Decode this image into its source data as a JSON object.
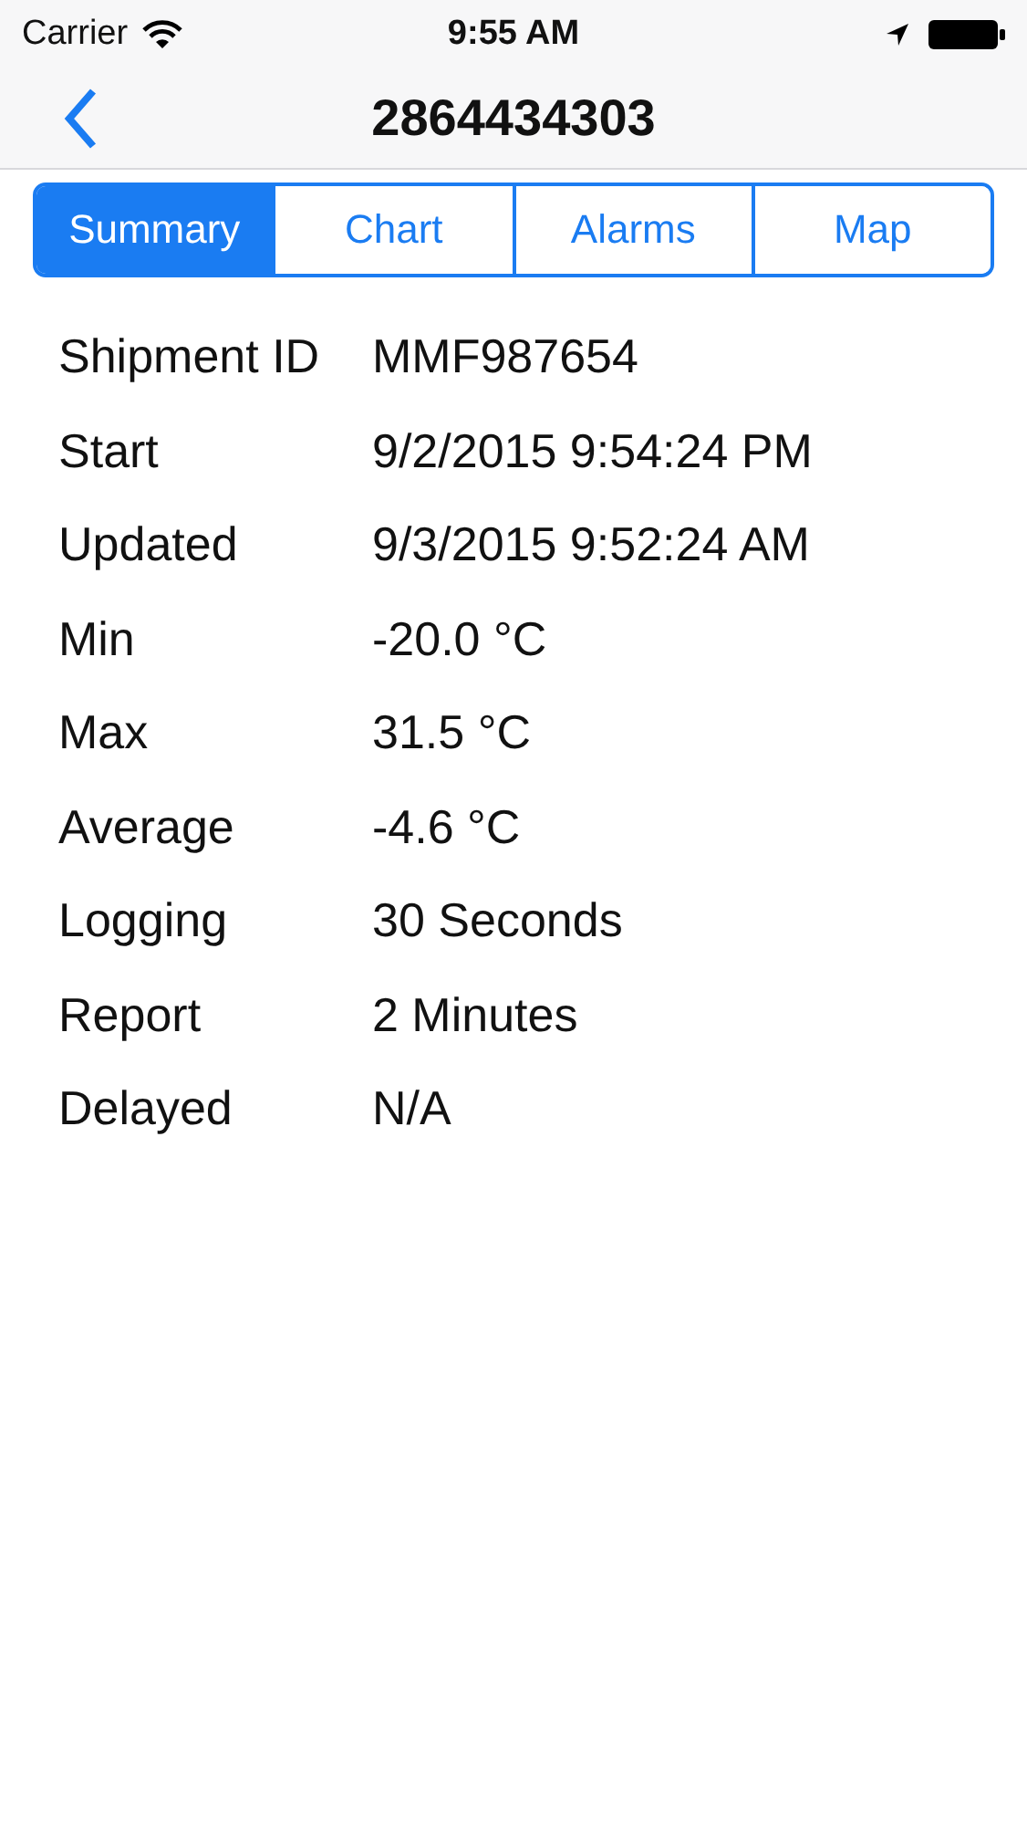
{
  "status_bar": {
    "carrier": "Carrier",
    "time": "9:55 AM"
  },
  "nav": {
    "title": "2864434303"
  },
  "tabs": [
    {
      "label": "Summary",
      "selected": true
    },
    {
      "label": "Chart",
      "selected": false
    },
    {
      "label": "Alarms",
      "selected": false
    },
    {
      "label": "Map",
      "selected": false
    }
  ],
  "details": [
    {
      "label": "Shipment ID",
      "value": "MMF987654"
    },
    {
      "label": "Start",
      "value": "9/2/2015 9:54:24 PM"
    },
    {
      "label": "Updated",
      "value": "9/3/2015 9:52:24 AM"
    },
    {
      "label": "Min",
      "value": "-20.0 °C"
    },
    {
      "label": "Max",
      "value": "31.5 °C"
    },
    {
      "label": "Average",
      "value": "-4.6 °C"
    },
    {
      "label": "Logging",
      "value": "30 Seconds"
    },
    {
      "label": "Report",
      "value": "2 Minutes"
    },
    {
      "label": "Delayed",
      "value": "N/A"
    }
  ]
}
